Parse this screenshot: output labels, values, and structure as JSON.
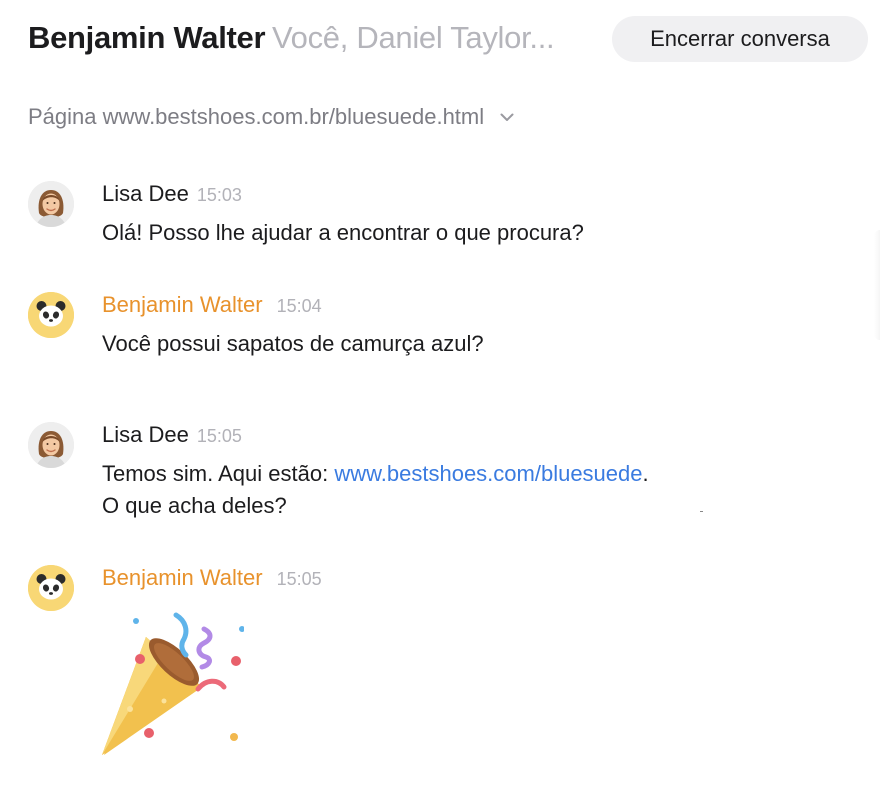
{
  "header": {
    "title": "Benjamin Walter",
    "participants": "Você, Daniel Taylor...",
    "end_button_label": "Encerrar conversa"
  },
  "page_info": {
    "label": "Página www.bestshoes.com.br/bluesuede.html",
    "icon": "chevron-down-icon"
  },
  "colors": {
    "visitor_name": "#e8922c",
    "link": "#3a7be0",
    "visitor_avatar_bg": "#f8d775"
  },
  "messages": [
    {
      "author": "Lisa Dee",
      "time": "15:03",
      "avatar": "agent-photo",
      "text": "Olá! Posso lhe ajudar a encontrar o que procura?"
    },
    {
      "author": "Benjamin Walter",
      "time": "15:04",
      "avatar": "panda-icon",
      "text": "Você possui sapatos de camurça azul?"
    },
    {
      "author": "Lisa Dee",
      "time": "15:05",
      "avatar": "agent-photo",
      "text_before_link": "Temos sim. Aqui estão: ",
      "link": "www.bestshoes.com/bluesuede",
      "text_after_link": ".",
      "line2": "O que acha deles?"
    },
    {
      "author": "Benjamin Walter",
      "time": "15:05",
      "avatar": "panda-icon",
      "sticker": "party-popper-icon"
    }
  ]
}
